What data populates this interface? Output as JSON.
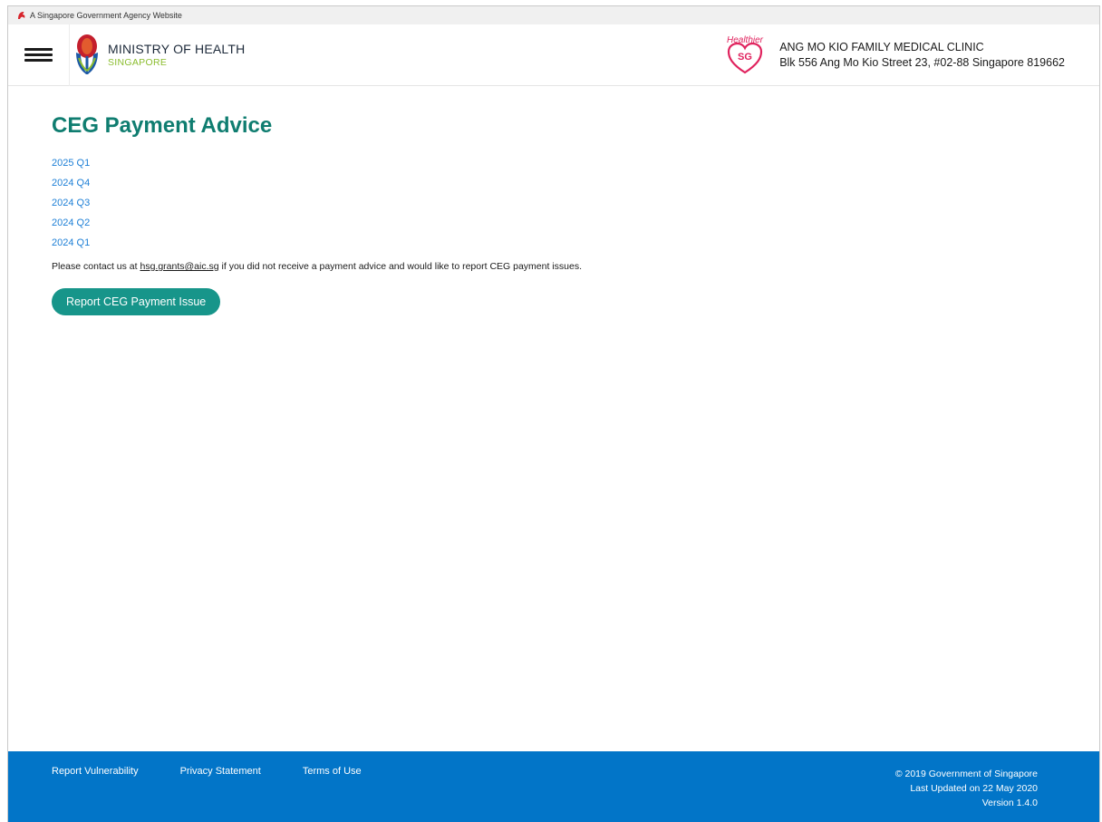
{
  "masthead": {
    "text": "A Singapore Government Agency Website"
  },
  "header": {
    "ministry_title": "MINISTRY OF HEALTH",
    "ministry_sub": "SINGAPORE",
    "healthier_logo_text": "Healthier",
    "healthier_logo_sg": "SG",
    "clinic_name": "ANG MO KIO FAMILY MEDICAL CLINIC",
    "clinic_address": "Blk 556 Ang Mo Kio Street 23, #02-88 Singapore 819662"
  },
  "main": {
    "title": "CEG Payment Advice",
    "quarters": [
      "2025 Q1",
      "2024 Q4",
      "2024 Q3",
      "2024 Q2",
      "2024 Q1"
    ],
    "contact_prefix": "Please contact us at ",
    "contact_email": "hsg.grants@aic.sg",
    "contact_suffix": " if you did not receive a payment advice and would like to report CEG payment issues.",
    "report_button": "Report CEG Payment Issue"
  },
  "footer": {
    "links": [
      "Report Vulnerability",
      "Privacy Statement",
      "Terms of Use"
    ],
    "copyright": "© 2019 Government of Singapore",
    "last_updated": "Last Updated on 22 May 2020",
    "version": "Version 1.4.0"
  },
  "colors": {
    "accent": "#0f7d70",
    "button": "#17958a",
    "link": "#1d7fd6",
    "footer": "#0275c8"
  },
  "icons": [
    "lion-icon",
    "hamburger-menu-icon",
    "moh-crest-icon",
    "healthier-sg-heart-icon"
  ]
}
